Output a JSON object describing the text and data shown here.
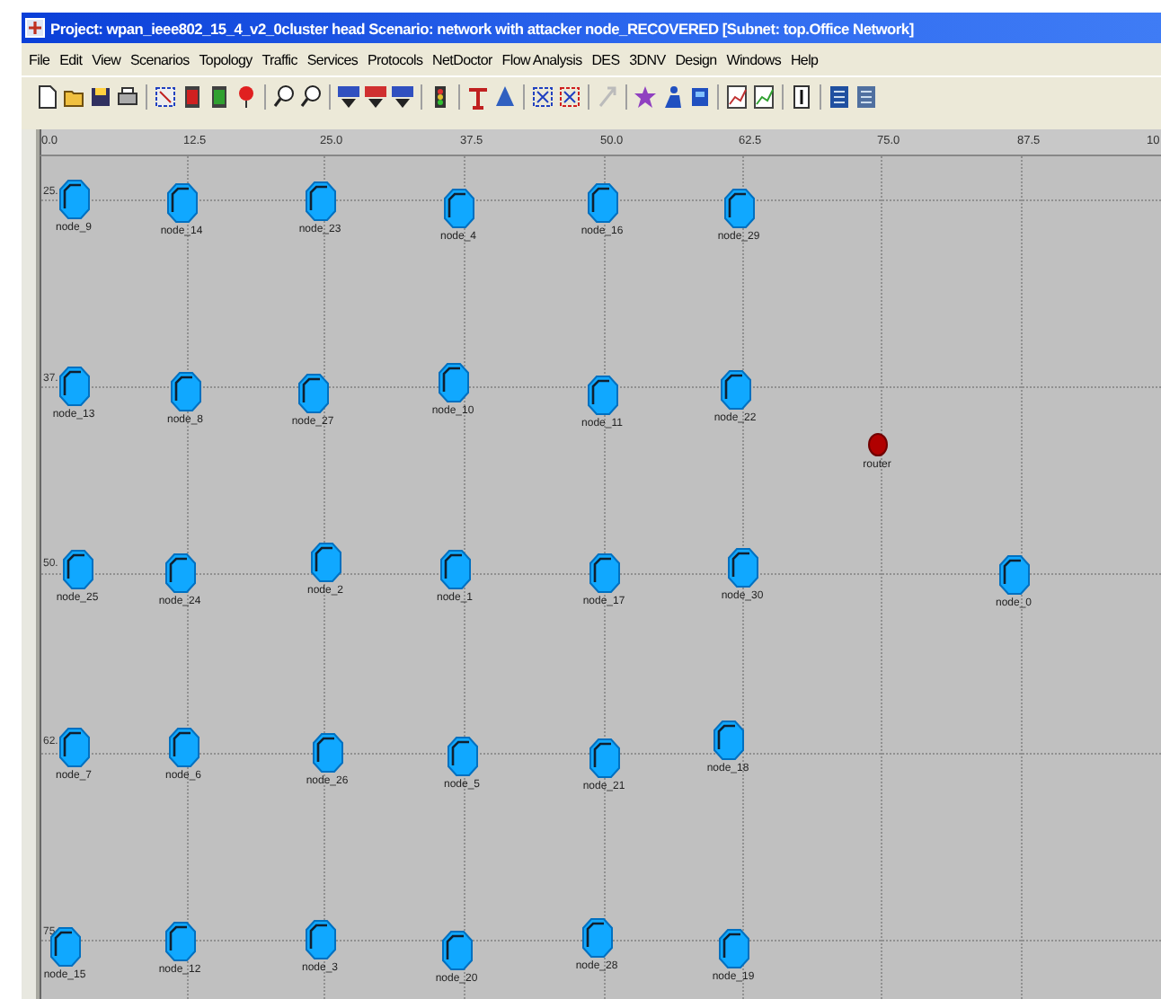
{
  "window": {
    "title": "Project: wpan_ieee802_15_4_v2_0cluster head Scenario: network with attacker node_RECOVERED  [Subnet: top.Office Network]"
  },
  "menu": [
    "File",
    "Edit",
    "View",
    "Scenarios",
    "Topology",
    "Traffic",
    "Services",
    "Protocols",
    "NetDoctor",
    "Flow Analysis",
    "DES",
    "3DNV",
    "Design",
    "Windows",
    "Help"
  ],
  "ruler": {
    "x_labels": [
      "0.0",
      "12.5",
      "25.0",
      "37.5",
      "50.0",
      "62.5",
      "75.0",
      "87.5",
      "10"
    ],
    "y_labels": [
      "25.",
      "37.",
      "50.",
      "62.",
      "75"
    ]
  },
  "nodes": [
    {
      "label": "node_9",
      "kind": "node"
    },
    {
      "label": "node_14",
      "kind": "node"
    },
    {
      "label": "node_23",
      "kind": "node"
    },
    {
      "label": "node_4",
      "kind": "node"
    },
    {
      "label": "node_16",
      "kind": "node"
    },
    {
      "label": "node_29",
      "kind": "node"
    },
    {
      "label": "node_13",
      "kind": "node"
    },
    {
      "label": "node_8",
      "kind": "node"
    },
    {
      "label": "node_27",
      "kind": "node"
    },
    {
      "label": "node_10",
      "kind": "node"
    },
    {
      "label": "node_11",
      "kind": "node"
    },
    {
      "label": "node_22",
      "kind": "node"
    },
    {
      "label": "router",
      "kind": "router"
    },
    {
      "label": "node_25",
      "kind": "node"
    },
    {
      "label": "node_24",
      "kind": "node"
    },
    {
      "label": "node_2",
      "kind": "node"
    },
    {
      "label": "node_1",
      "kind": "node"
    },
    {
      "label": "node_17",
      "kind": "node"
    },
    {
      "label": "node_30",
      "kind": "node"
    },
    {
      "label": "node_0",
      "kind": "node"
    },
    {
      "label": "node_7",
      "kind": "node"
    },
    {
      "label": "node_6",
      "kind": "node"
    },
    {
      "label": "node_26",
      "kind": "node"
    },
    {
      "label": "node_5",
      "kind": "node"
    },
    {
      "label": "node_21",
      "kind": "node"
    },
    {
      "label": "node_18",
      "kind": "node"
    },
    {
      "label": "node_15",
      "kind": "node"
    },
    {
      "label": "node_12",
      "kind": "node"
    },
    {
      "label": "node_3",
      "kind": "node"
    },
    {
      "label": "node_20",
      "kind": "node"
    },
    {
      "label": "node_28",
      "kind": "node"
    },
    {
      "label": "node_19",
      "kind": "node"
    }
  ]
}
